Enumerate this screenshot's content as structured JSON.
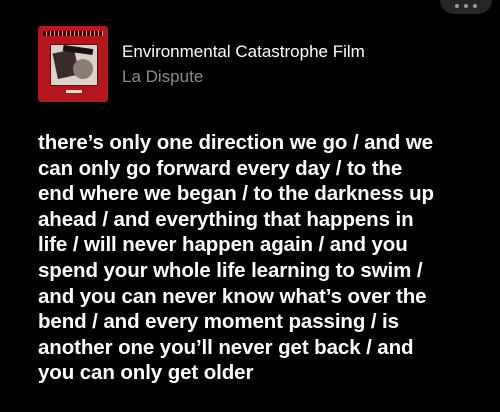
{
  "track": {
    "title": "Environmental Catastrophe Film",
    "artist": "La Dispute"
  },
  "icons": {
    "more": "ellipsis-icon",
    "album_art": "album-art-image"
  },
  "colors": {
    "background": "#000000",
    "primary_text": "#ffffff",
    "secondary_text": "#8a8a8f",
    "album_art_red": "#b5161c"
  },
  "lyrics": [
    "there’s only one direction we go / and we",
    "can only go forward every day / to the",
    "end where we began / to the darkness up",
    "ahead / and everything that happens in",
    "life / will never happen again / and you",
    "spend your whole life learning to swim /",
    "and you can never know what’s over the",
    "bend / and every moment passing / is",
    "another one you’ll never get back / and",
    "you can only get older"
  ]
}
